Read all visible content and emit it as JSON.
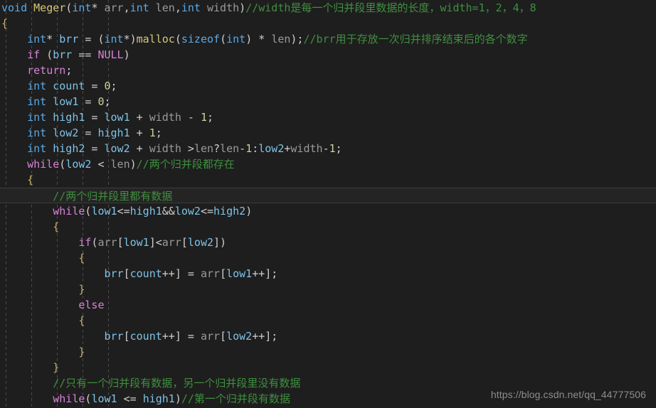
{
  "editor": {
    "background_color": "#1e1e1e",
    "active_line_color": "#242424",
    "language": "c",
    "active_line_index": 12
  },
  "colors": {
    "keyword_type": "#5aa9e6",
    "keyword_control": "#d782d7",
    "function_name": "#d6c77a",
    "parameter": "#9a9a9a",
    "local_variable": "#7fc3e8",
    "number": "#c8d49a",
    "punctuation": "#cfcfcf",
    "brace": "#c4b06a",
    "comment": "#3f8f3f",
    "watermark": "#8d8d8d"
  },
  "watermark": {
    "text": "https://blog.csdn.net/qq_44777506"
  },
  "code": {
    "lines": [
      {
        "index": 0,
        "active": false,
        "tokens": [
          {
            "t": "void",
            "c": "kw"
          },
          {
            "t": " ",
            "c": "punc"
          },
          {
            "t": "Meger",
            "c": "fn"
          },
          {
            "t": "(",
            "c": "punc"
          },
          {
            "t": "int",
            "c": "kw"
          },
          {
            "t": "* ",
            "c": "punc"
          },
          {
            "t": "arr",
            "c": "param"
          },
          {
            "t": ",",
            "c": "punc"
          },
          {
            "t": "int",
            "c": "kw"
          },
          {
            "t": " ",
            "c": "punc"
          },
          {
            "t": "len",
            "c": "param"
          },
          {
            "t": ",",
            "c": "punc"
          },
          {
            "t": "int",
            "c": "kw"
          },
          {
            "t": " ",
            "c": "punc"
          },
          {
            "t": "width",
            "c": "param"
          },
          {
            "t": ")",
            "c": "punc"
          },
          {
            "t": "//width是每一个归并段里数据的长度，width=1，2，4，8",
            "c": "cmt"
          }
        ]
      },
      {
        "index": 1,
        "active": false,
        "tokens": [
          {
            "t": "{",
            "c": "brace"
          }
        ]
      },
      {
        "index": 2,
        "active": false,
        "tokens": [
          {
            "t": "    ",
            "c": "punc"
          },
          {
            "t": "int",
            "c": "kw"
          },
          {
            "t": "* ",
            "c": "punc"
          },
          {
            "t": "brr",
            "c": "var"
          },
          {
            "t": " = ",
            "c": "punc"
          },
          {
            "t": "(",
            "c": "punc"
          },
          {
            "t": "int",
            "c": "kw"
          },
          {
            "t": "*)",
            "c": "punc"
          },
          {
            "t": "malloc",
            "c": "fn"
          },
          {
            "t": "(",
            "c": "punc"
          },
          {
            "t": "sizeof",
            "c": "kw"
          },
          {
            "t": "(",
            "c": "punc"
          },
          {
            "t": "int",
            "c": "kw"
          },
          {
            "t": ") * ",
            "c": "punc"
          },
          {
            "t": "len",
            "c": "param"
          },
          {
            "t": ");",
            "c": "punc"
          },
          {
            "t": "//brr用于存放一次归并排序结束后的各个数字",
            "c": "cmt"
          }
        ]
      },
      {
        "index": 3,
        "active": false,
        "tokens": [
          {
            "t": "    ",
            "c": "punc"
          },
          {
            "t": "if",
            "c": "kw2"
          },
          {
            "t": " (",
            "c": "punc"
          },
          {
            "t": "brr",
            "c": "var"
          },
          {
            "t": " == ",
            "c": "punc"
          },
          {
            "t": "NULL",
            "c": "kw2"
          },
          {
            "t": ")",
            "c": "punc"
          }
        ]
      },
      {
        "index": 4,
        "active": false,
        "tokens": [
          {
            "t": "    ",
            "c": "punc"
          },
          {
            "t": "return",
            "c": "kw2"
          },
          {
            "t": ";",
            "c": "punc"
          }
        ]
      },
      {
        "index": 5,
        "active": false,
        "tokens": [
          {
            "t": "    ",
            "c": "punc"
          },
          {
            "t": "int",
            "c": "kw"
          },
          {
            "t": " ",
            "c": "punc"
          },
          {
            "t": "count",
            "c": "var"
          },
          {
            "t": " = ",
            "c": "punc"
          },
          {
            "t": "0",
            "c": "num"
          },
          {
            "t": ";",
            "c": "punc"
          }
        ]
      },
      {
        "index": 6,
        "active": false,
        "tokens": [
          {
            "t": "    ",
            "c": "punc"
          },
          {
            "t": "int",
            "c": "kw"
          },
          {
            "t": " ",
            "c": "punc"
          },
          {
            "t": "low1",
            "c": "var"
          },
          {
            "t": " = ",
            "c": "punc"
          },
          {
            "t": "0",
            "c": "num"
          },
          {
            "t": ";",
            "c": "punc"
          }
        ]
      },
      {
        "index": 7,
        "active": false,
        "tokens": [
          {
            "t": "    ",
            "c": "punc"
          },
          {
            "t": "int",
            "c": "kw"
          },
          {
            "t": " ",
            "c": "punc"
          },
          {
            "t": "high1",
            "c": "var"
          },
          {
            "t": " = ",
            "c": "punc"
          },
          {
            "t": "low1",
            "c": "var"
          },
          {
            "t": " + ",
            "c": "punc"
          },
          {
            "t": "width",
            "c": "param"
          },
          {
            "t": " - ",
            "c": "punc"
          },
          {
            "t": "1",
            "c": "num"
          },
          {
            "t": ";",
            "c": "punc"
          }
        ]
      },
      {
        "index": 8,
        "active": false,
        "tokens": [
          {
            "t": "    ",
            "c": "punc"
          },
          {
            "t": "int",
            "c": "kw"
          },
          {
            "t": " ",
            "c": "punc"
          },
          {
            "t": "low2",
            "c": "var"
          },
          {
            "t": " = ",
            "c": "punc"
          },
          {
            "t": "high1",
            "c": "var"
          },
          {
            "t": " + ",
            "c": "punc"
          },
          {
            "t": "1",
            "c": "num"
          },
          {
            "t": ";",
            "c": "punc"
          }
        ]
      },
      {
        "index": 9,
        "active": false,
        "tokens": [
          {
            "t": "    ",
            "c": "punc"
          },
          {
            "t": "int",
            "c": "kw"
          },
          {
            "t": " ",
            "c": "punc"
          },
          {
            "t": "high2",
            "c": "var"
          },
          {
            "t": " = ",
            "c": "punc"
          },
          {
            "t": "low2",
            "c": "var"
          },
          {
            "t": " + ",
            "c": "punc"
          },
          {
            "t": "width",
            "c": "param"
          },
          {
            "t": " >",
            "c": "punc"
          },
          {
            "t": "len",
            "c": "param"
          },
          {
            "t": "?",
            "c": "punc"
          },
          {
            "t": "len",
            "c": "param"
          },
          {
            "t": "-",
            "c": "punc"
          },
          {
            "t": "1",
            "c": "num"
          },
          {
            "t": ":",
            "c": "punc"
          },
          {
            "t": "low2",
            "c": "var"
          },
          {
            "t": "+",
            "c": "punc"
          },
          {
            "t": "width",
            "c": "param"
          },
          {
            "t": "-",
            "c": "punc"
          },
          {
            "t": "1",
            "c": "num"
          },
          {
            "t": ";",
            "c": "punc"
          }
        ]
      },
      {
        "index": 10,
        "active": false,
        "tokens": [
          {
            "t": "    ",
            "c": "punc"
          },
          {
            "t": "while",
            "c": "kw2"
          },
          {
            "t": "(",
            "c": "punc"
          },
          {
            "t": "low2",
            "c": "var"
          },
          {
            "t": " < ",
            "c": "punc"
          },
          {
            "t": "len",
            "c": "param"
          },
          {
            "t": ")",
            "c": "punc"
          },
          {
            "t": "//两个归并段都存在",
            "c": "cmt"
          }
        ]
      },
      {
        "index": 11,
        "active": false,
        "tokens": [
          {
            "t": "    ",
            "c": "punc"
          },
          {
            "t": "{",
            "c": "brace"
          }
        ]
      },
      {
        "index": 12,
        "active": true,
        "tokens": [
          {
            "t": "        ",
            "c": "punc"
          },
          {
            "t": "//两个归并段里都有数据",
            "c": "cmt"
          }
        ]
      },
      {
        "index": 13,
        "active": false,
        "tokens": [
          {
            "t": "        ",
            "c": "punc"
          },
          {
            "t": "while",
            "c": "kw2"
          },
          {
            "t": "(",
            "c": "punc"
          },
          {
            "t": "low1",
            "c": "var"
          },
          {
            "t": "<=",
            "c": "punc"
          },
          {
            "t": "high1",
            "c": "var"
          },
          {
            "t": "&&",
            "c": "punc"
          },
          {
            "t": "low2",
            "c": "var"
          },
          {
            "t": "<=",
            "c": "punc"
          },
          {
            "t": "high2",
            "c": "var"
          },
          {
            "t": ")",
            "c": "punc"
          }
        ]
      },
      {
        "index": 14,
        "active": false,
        "tokens": [
          {
            "t": "        ",
            "c": "punc"
          },
          {
            "t": "{",
            "c": "brace"
          }
        ]
      },
      {
        "index": 15,
        "active": false,
        "tokens": [
          {
            "t": "            ",
            "c": "punc"
          },
          {
            "t": "if",
            "c": "kw2"
          },
          {
            "t": "(",
            "c": "punc"
          },
          {
            "t": "arr",
            "c": "param"
          },
          {
            "t": "[",
            "c": "punc"
          },
          {
            "t": "low1",
            "c": "var"
          },
          {
            "t": "]<",
            "c": "punc"
          },
          {
            "t": "arr",
            "c": "param"
          },
          {
            "t": "[",
            "c": "punc"
          },
          {
            "t": "low2",
            "c": "var"
          },
          {
            "t": "])",
            "c": "punc"
          }
        ]
      },
      {
        "index": 16,
        "active": false,
        "tokens": [
          {
            "t": "            ",
            "c": "punc"
          },
          {
            "t": "{",
            "c": "brace"
          }
        ]
      },
      {
        "index": 17,
        "active": false,
        "tokens": [
          {
            "t": "                ",
            "c": "punc"
          },
          {
            "t": "brr",
            "c": "var"
          },
          {
            "t": "[",
            "c": "punc"
          },
          {
            "t": "count",
            "c": "var"
          },
          {
            "t": "++] = ",
            "c": "punc"
          },
          {
            "t": "arr",
            "c": "param"
          },
          {
            "t": "[",
            "c": "punc"
          },
          {
            "t": "low1",
            "c": "var"
          },
          {
            "t": "++];",
            "c": "punc"
          }
        ]
      },
      {
        "index": 18,
        "active": false,
        "tokens": [
          {
            "t": "            ",
            "c": "punc"
          },
          {
            "t": "}",
            "c": "brace"
          }
        ]
      },
      {
        "index": 19,
        "active": false,
        "tokens": [
          {
            "t": "            ",
            "c": "punc"
          },
          {
            "t": "else",
            "c": "kw2"
          }
        ]
      },
      {
        "index": 20,
        "active": false,
        "tokens": [
          {
            "t": "            ",
            "c": "punc"
          },
          {
            "t": "{",
            "c": "brace"
          }
        ]
      },
      {
        "index": 21,
        "active": false,
        "tokens": [
          {
            "t": "                ",
            "c": "punc"
          },
          {
            "t": "brr",
            "c": "var"
          },
          {
            "t": "[",
            "c": "punc"
          },
          {
            "t": "count",
            "c": "var"
          },
          {
            "t": "++] = ",
            "c": "punc"
          },
          {
            "t": "arr",
            "c": "param"
          },
          {
            "t": "[",
            "c": "punc"
          },
          {
            "t": "low2",
            "c": "var"
          },
          {
            "t": "++];",
            "c": "punc"
          }
        ]
      },
      {
        "index": 22,
        "active": false,
        "tokens": [
          {
            "t": "            ",
            "c": "punc"
          },
          {
            "t": "}",
            "c": "brace"
          }
        ]
      },
      {
        "index": 23,
        "active": false,
        "tokens": [
          {
            "t": "        ",
            "c": "punc"
          },
          {
            "t": "}",
            "c": "brace"
          }
        ]
      },
      {
        "index": 24,
        "active": false,
        "tokens": [
          {
            "t": "        ",
            "c": "punc"
          },
          {
            "t": "//只有一个归并段有数据，另一个归并段里没有数据",
            "c": "cmt"
          }
        ]
      },
      {
        "index": 25,
        "active": false,
        "tokens": [
          {
            "t": "        ",
            "c": "punc"
          },
          {
            "t": "while",
            "c": "kw2"
          },
          {
            "t": "(",
            "c": "punc"
          },
          {
            "t": "low1",
            "c": "var"
          },
          {
            "t": " <= ",
            "c": "punc"
          },
          {
            "t": "high1",
            "c": "var"
          },
          {
            "t": ")",
            "c": "punc"
          },
          {
            "t": "//第一个归并段有数据",
            "c": "cmt"
          }
        ]
      }
    ]
  },
  "indent_guides": {
    "x_positions": [
      8,
      44,
      80,
      116,
      152
    ]
  }
}
